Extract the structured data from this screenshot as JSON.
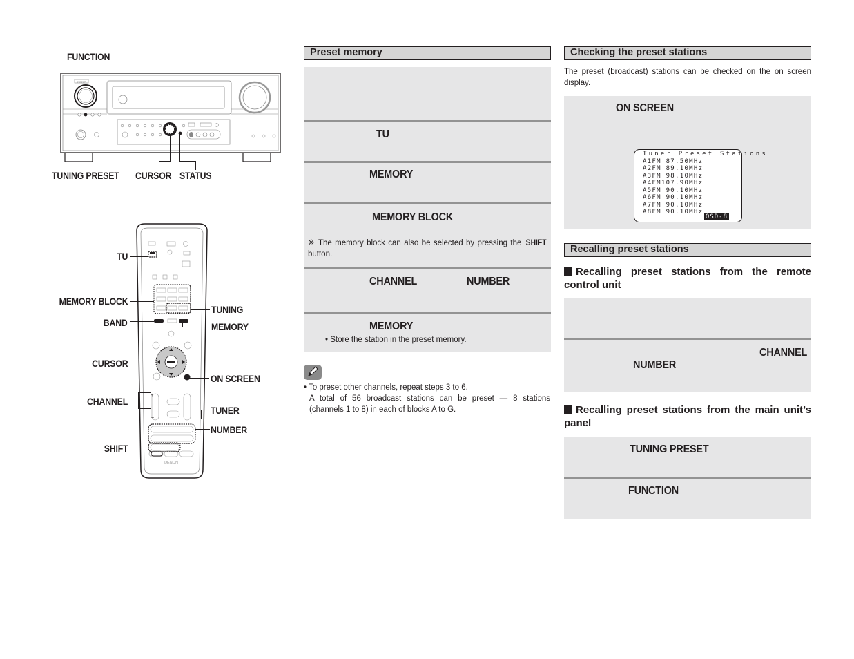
{
  "left_panel": {
    "receiver_labels": {
      "function": "FUNCTION",
      "tuning_preset": "TUNING PRESET",
      "cursor": "CURSOR",
      "status": "STATUS"
    },
    "receiver_brand": "DENON",
    "remote_labels": {
      "tu": "TU",
      "memory_block": "MEMORY BLOCK",
      "tuning": "TUNING",
      "band": "BAND",
      "memory": "MEMORY",
      "cursor": "CURSOR",
      "on_screen": "ON SCREEN",
      "channel": "CHANNEL",
      "tuner": "TUNER",
      "number": "NUMBER",
      "shift": "SHIFT"
    },
    "remote_brand": "DENON"
  },
  "preset_memory": {
    "heading": "Preset memory",
    "steps": [
      {
        "keywords": []
      },
      {
        "keywords": [
          "TU"
        ]
      },
      {
        "keywords": [
          "MEMORY"
        ]
      },
      {
        "keywords": [
          "MEMORY BLOCK"
        ],
        "note_mark": "※",
        "note_pre": "The memory block can also be selected by pressing the ",
        "note_bold": "SHIFT",
        "note_post": " button."
      },
      {
        "keywords": [
          "CHANNEL",
          "NUMBER"
        ]
      },
      {
        "keywords": [
          "MEMORY"
        ],
        "bullet": "Store the station in the preset memory."
      }
    ],
    "tip_icon": "pencil-icon",
    "tips": {
      "line1": "To preset other channels, repeat steps 3 to 6.",
      "line2": "A total of 56 broadcast stations can be preset — 8 stations (channels 1 to 8) in each of blocks A to G."
    }
  },
  "checking": {
    "heading": "Checking the preset stations",
    "intro": "The preset (broadcast) stations can be checked on the on screen display.",
    "step_keyword": "ON SCREEN",
    "osd": {
      "title": "Tuner Preset Stations",
      "rows": [
        {
          "ch": "A1",
          "band": "FM",
          "freq": " 87.50",
          "unit": "MHz"
        },
        {
          "ch": "A2",
          "band": "FM",
          "freq": " 89.10",
          "unit": "MHz"
        },
        {
          "ch": "A3",
          "band": "FM",
          "freq": " 98.10",
          "unit": "MHz"
        },
        {
          "ch": "A4",
          "band": "FM",
          "freq": "107.90",
          "unit": "MHz"
        },
        {
          "ch": "A5",
          "band": "FM",
          "freq": " 90.10",
          "unit": "MHz"
        },
        {
          "ch": "A6",
          "band": "FM",
          "freq": " 90.10",
          "unit": "MHz"
        },
        {
          "ch": "A7",
          "band": "FM",
          "freq": " 90.10",
          "unit": "MHz"
        },
        {
          "ch": "A8",
          "band": "FM",
          "freq": " 90.10",
          "unit": "MHz"
        }
      ],
      "tag": "OSD-8"
    }
  },
  "recalling": {
    "heading": "Recalling preset stations",
    "remote_sub": "Recalling preset stations from the remote control unit",
    "remote_steps": [
      {
        "keywords": []
      },
      {
        "keywords": [
          "CHANNEL",
          "NUMBER"
        ]
      }
    ],
    "panel_sub": "Recalling preset stations from the main unit’s panel",
    "panel_steps": [
      {
        "keywords": [
          "TUNING PRESET"
        ]
      },
      {
        "keywords": [
          "FUNCTION"
        ]
      }
    ]
  },
  "colors": {
    "heading_bg": "#d5d5d5",
    "step_bg": "#e6e6e7",
    "step_separator": "#939393",
    "text": "#231f20"
  }
}
